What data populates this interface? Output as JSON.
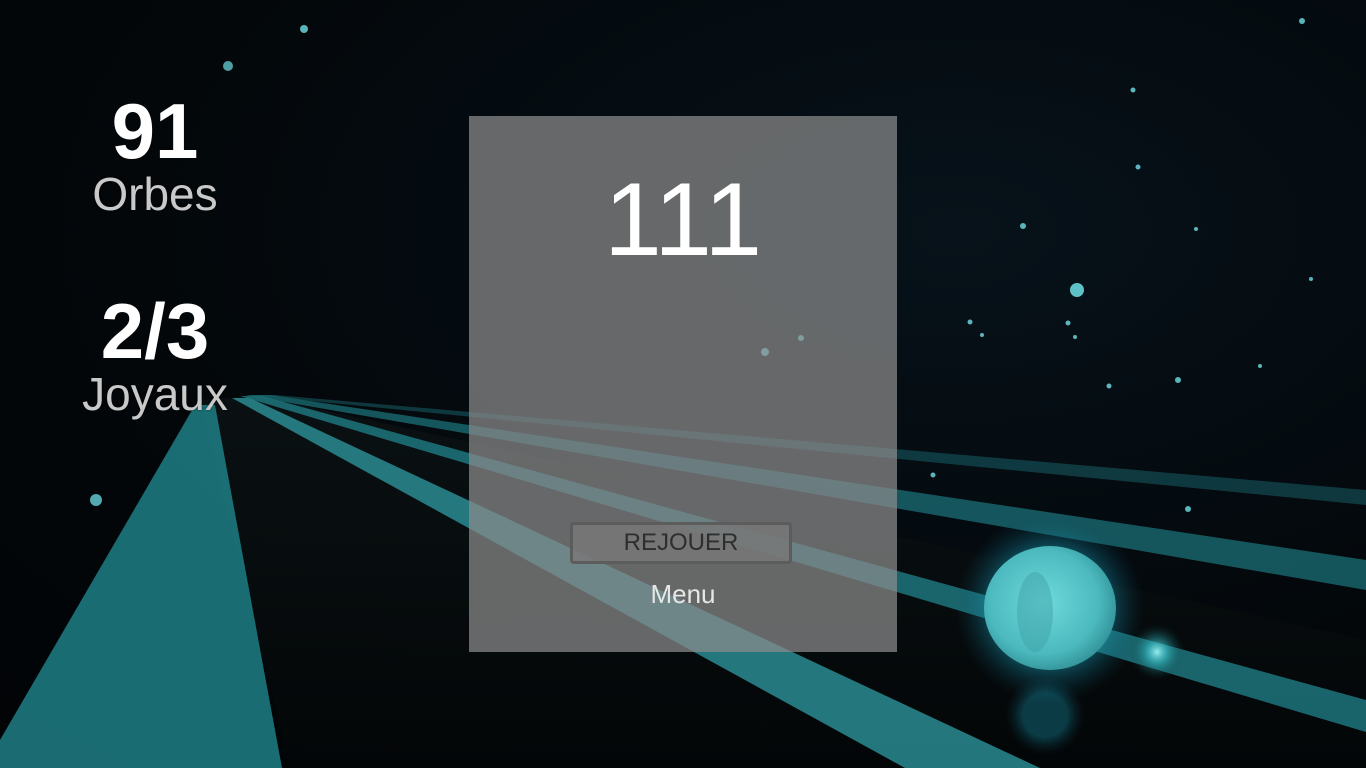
{
  "hud": {
    "orbs": {
      "value": "91",
      "label": "Orbes"
    },
    "gems": {
      "value": "2/3",
      "label": "Joyaux"
    }
  },
  "result": {
    "score": "111",
    "replay_label": "REJOUER",
    "menu_label": "Menu"
  },
  "colors": {
    "beam": "#1f8e94",
    "orb": "#5fd7dc",
    "panel": "#8c8c8c"
  }
}
